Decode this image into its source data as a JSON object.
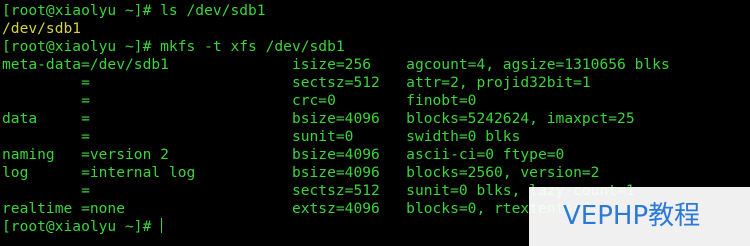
{
  "terminal": {
    "lines": [
      {
        "text": "[root@xiaolyu ~]# ls /dev/sdb1",
        "kind": "prompt"
      },
      {
        "text": "/dev/sdb1",
        "kind": "output"
      },
      {
        "text": "[root@xiaolyu ~]# mkfs -t xfs /dev/sdb1",
        "kind": "prompt"
      },
      {
        "text": "meta-data=/dev/sdb1              isize=256    agcount=4, agsize=1310656 blks",
        "kind": "text"
      },
      {
        "text": "         =                       sectsz=512   attr=2, projid32bit=1",
        "kind": "text"
      },
      {
        "text": "         =                       crc=0        finobt=0",
        "kind": "text"
      },
      {
        "text": "data     =                       bsize=4096   blocks=5242624, imaxpct=25",
        "kind": "text"
      },
      {
        "text": "         =                       sunit=0      swidth=0 blks",
        "kind": "text"
      },
      {
        "text": "naming   =version 2              bsize=4096   ascii-ci=0 ftype=0",
        "kind": "text"
      },
      {
        "text": "log      =internal log           bsize=4096   blocks=2560, version=2",
        "kind": "text"
      },
      {
        "text": "         =                       sectsz=512   sunit=0 blks, lazy-count=1",
        "kind": "text"
      },
      {
        "text": "realtime =none                   extsz=4096   blocks=0, rtextents=0",
        "kind": "text"
      },
      {
        "text": "[root@xiaolyu ~]# ",
        "kind": "prompt"
      }
    ]
  },
  "watermark": {
    "text": "VEPHP教程"
  },
  "colors": {
    "background": "#000000",
    "text_green": "#3bd43b",
    "output_yellow": "#d4d43b",
    "watermark_blue": "#2b79d8"
  }
}
